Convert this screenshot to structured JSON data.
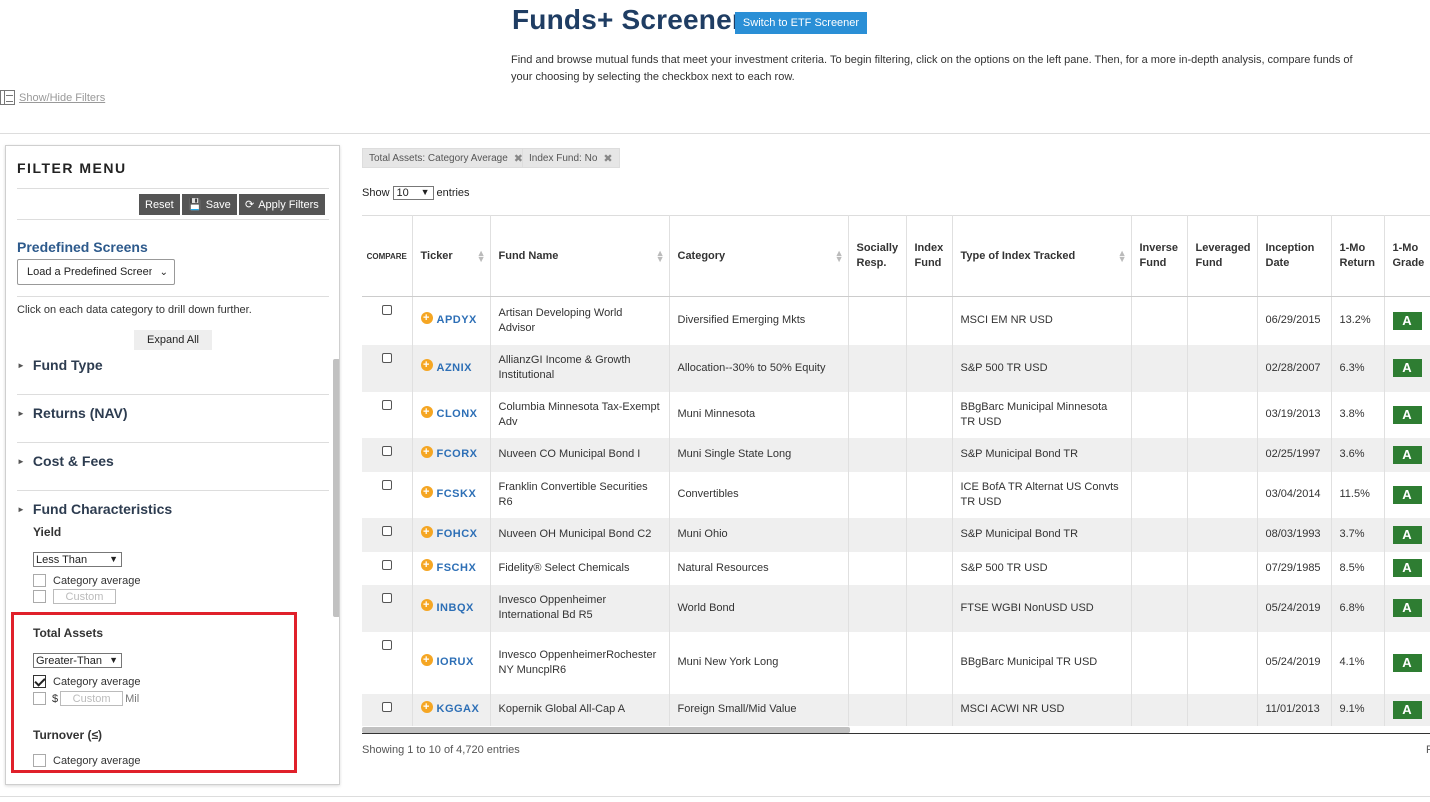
{
  "header": {
    "title": "Funds+ Screener",
    "etf_button": "Switch to ETF Screener",
    "description": "Find and browse mutual funds that meet your investment criteria. To begin filtering, click on the options on the left pane. Then, for a more in-depth analysis, compare funds of your choosing by selecting the checkbox next to each row.",
    "show_hide": "Show/Hide Filters"
  },
  "filter_menu": {
    "title": "FILTER MENU",
    "reset": "Reset",
    "save": "Save",
    "apply": "Apply Filters",
    "predefined_title": "Predefined Screens",
    "predefined_select": "Load a Predefined Screen",
    "drill_text": "Click on each data category to drill down further.",
    "expand_all": "Expand All",
    "categories": [
      "Fund Type",
      "Returns (NAV)",
      "Cost & Fees",
      "Fund Characteristics"
    ],
    "yield": {
      "label": "Yield",
      "select": "Less Than",
      "category_avg": "Category average",
      "custom_placeholder": "Custom"
    },
    "total_assets": {
      "label": "Total Assets",
      "select": "Greater-Than",
      "category_avg": "Category average",
      "category_avg_checked": true,
      "currency": "$",
      "custom_placeholder": "Custom",
      "unit": "Mil"
    },
    "turnover": {
      "label": "Turnover (≤)",
      "category_avg": "Category average"
    }
  },
  "active_filters": [
    "Total Assets: Category Average",
    "Index Fund: No"
  ],
  "entries": {
    "show": "Show",
    "value": "10",
    "suffix": "entries",
    "showing": "Showing 1 to 10 of 4,720 entries",
    "pager_fragment": "F"
  },
  "table": {
    "columns": [
      "COMPARE",
      "Ticker",
      "Fund Name",
      "Category",
      "Socially Resp.",
      "Index Fund",
      "Type of Index Tracked",
      "Inverse Fund",
      "Leveraged Fund",
      "Inception Date",
      "1-Mo Return",
      "1-Mo Grade"
    ],
    "rows": [
      {
        "ticker": "APDYX",
        "name": "Artisan Developing World Advisor",
        "category": "Diversified Emerging Mkts",
        "index": "MSCI EM NR USD",
        "inception": "06/29/2015",
        "return": "13.2%",
        "grade": "A"
      },
      {
        "ticker": "AZNIX",
        "name": "AllianzGI Income & Growth Institutional",
        "category": "Allocation--30% to 50% Equity",
        "index": "S&P 500 TR USD",
        "inception": "02/28/2007",
        "return": "6.3%",
        "grade": "A"
      },
      {
        "ticker": "CLONX",
        "name": "Columbia Minnesota Tax-Exempt Adv",
        "category": "Muni Minnesota",
        "index": "BBgBarc Municipal Minnesota TR USD",
        "inception": "03/19/2013",
        "return": "3.8%",
        "grade": "A"
      },
      {
        "ticker": "FCORX",
        "name": "Nuveen CO Municipal Bond I",
        "category": "Muni Single State Long",
        "index": "S&P Municipal Bond TR",
        "inception": "02/25/1997",
        "return": "3.6%",
        "grade": "A"
      },
      {
        "ticker": "FCSKX",
        "name": "Franklin Convertible Securities R6",
        "category": "Convertibles",
        "index": "ICE BofA TR Alternat US Convts TR USD",
        "inception": "03/04/2014",
        "return": "11.5%",
        "grade": "A"
      },
      {
        "ticker": "FOHCX",
        "name": "Nuveen OH Municipal Bond C2",
        "category": "Muni Ohio",
        "index": "S&P Municipal Bond TR",
        "inception": "08/03/1993",
        "return": "3.7%",
        "grade": "A"
      },
      {
        "ticker": "FSCHX",
        "name": "Fidelity® Select Chemicals",
        "category": "Natural Resources",
        "index": "S&P 500 TR USD",
        "inception": "07/29/1985",
        "return": "8.5%",
        "grade": "A"
      },
      {
        "ticker": "INBQX",
        "name": "Invesco Oppenheimer International Bd R5",
        "category": "World Bond",
        "index": "FTSE WGBI NonUSD USD",
        "inception": "05/24/2019",
        "return": "6.8%",
        "grade": "A"
      },
      {
        "ticker": "IORUX",
        "name": "Invesco OppenheimerRochester NY MuncplR6",
        "category": "Muni New York Long",
        "index": "BBgBarc Municipal TR USD",
        "inception": "05/24/2019",
        "return": "4.1%",
        "grade": "A"
      },
      {
        "ticker": "KGGAX",
        "name": "Kopernik Global All-Cap A",
        "category": "Foreign Small/Mid Value",
        "index": "MSCI ACWI NR USD",
        "inception": "11/01/2013",
        "return": "9.1%",
        "grade": "A"
      }
    ]
  },
  "colors": {
    "title": "#1f3d63",
    "etf_button": "#2a8fd6",
    "link": "#2d6fb6",
    "grade_green": "#2e7d32",
    "plus_orange": "#f5a623",
    "highlight_red": "#e0202a"
  }
}
